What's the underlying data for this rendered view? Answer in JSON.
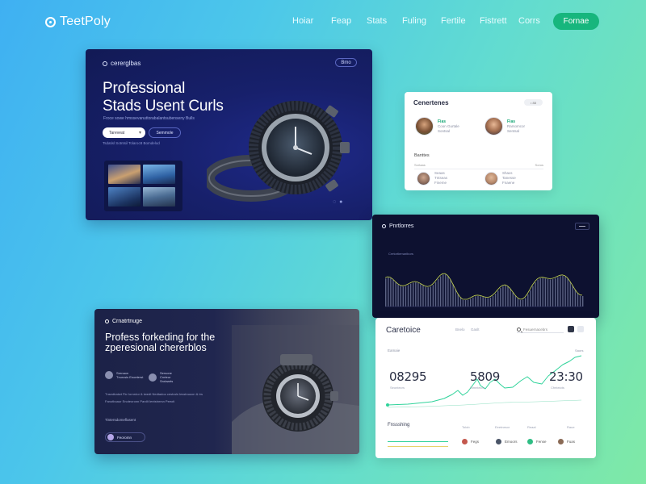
{
  "nav": {
    "brand": "TeetPoly",
    "links": [
      "Hoiar",
      "Feap",
      "Stats",
      "Fuling",
      "Fertile",
      "Fistrett",
      "Corrs"
    ],
    "cta": "Fornae"
  },
  "hero": {
    "brand": "cererglbas",
    "pill": "Bmo",
    "title_line1": "Professional",
    "title_line2": "Stads Usent Curls",
    "subtitle": "Froce sowe hmssevanuttorabalantsubenseny Bulls",
    "select_value": "Tareveat",
    "button": "Semmole",
    "note": "Tsdatisl Sotntsil Tolaroc8 Bomdelod"
  },
  "contacts": {
    "title": "Cenertenes",
    "toggle": "• 88",
    "people": [
      {
        "name": "Fias",
        "line2": "Coon Gurtale",
        "line3": "Sontsal"
      },
      {
        "name": "Fias",
        "line2": "Rarsomcor",
        "line3": "Sentsal"
      }
    ],
    "section": "Banttes",
    "row_left": "Sortaas",
    "row_right": "Soros",
    "people2": [
      {
        "name": "Seaas",
        "line2": "Tntseas",
        "line3": "Fineme"
      },
      {
        "name": "Shaxs",
        "line2": "Tanesse",
        "line3": "Fnaene"
      }
    ]
  },
  "dark_chart": {
    "title": "Pnrtlorres",
    "subtitle": "Cretortlemaribors"
  },
  "analytics": {
    "title": "Caretoice",
    "tabs": [
      "Bnelo",
      "Gaslt"
    ],
    "search": "Fesuernacebrs",
    "label_left": "Eamaie",
    "label_right": "Saors",
    "stats": [
      {
        "value": "08295",
        "sub": "Seontecrs"
      },
      {
        "value": "5809",
        "sub": "Stmntecrs"
      },
      {
        "value": "23:30",
        "sub": "Cfmteiots"
      }
    ],
    "section": "Fnssshing",
    "columns": [
      "Tolob",
      "Eeetnesor",
      "Reaal",
      "Raue"
    ],
    "legend": [
      {
        "label": "Fegs"
      },
      {
        "label": "Emoors"
      },
      {
        "label": "Fense"
      },
      {
        "label": "Fuas"
      }
    ],
    "colors": {
      "accent": "#2fd39a",
      "muted": "#8fdfc2"
    }
  },
  "promo": {
    "brand": "Crnatrtnuge",
    "title": "Profess forkeding for the zperesional chererblos",
    "mini": [
      {
        "a": "Srenaon",
        "b": "Tnurcsis Enoeterst"
      },
      {
        "a": "Sersone",
        "b": "Cnrteor",
        "c": "Srotaarts"
      }
    ],
    "body": "Tnsedtratwt Fkr Iornrdor & twedt Nedtadoo cestraln Iesstnuoon & trs Fanotboaur Enoteoronn Pardlt Ientstnrrsn Peeoti",
    "caption": "Tintersdomeflasent",
    "button": "Feoromn"
  }
}
